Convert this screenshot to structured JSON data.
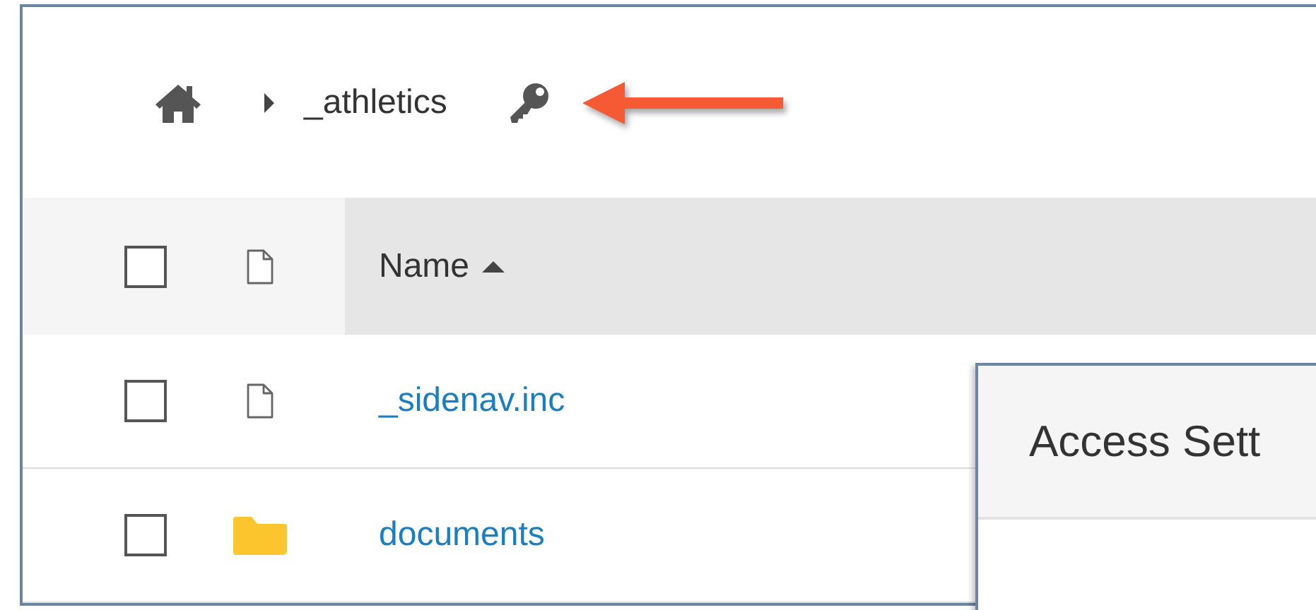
{
  "breadcrumb": {
    "items": [
      {
        "label": "_athletics"
      }
    ],
    "locked": true
  },
  "annotation": {
    "kind": "arrow"
  },
  "table": {
    "select_all": {
      "checked": false
    },
    "columns": [
      {
        "label": "Name",
        "sort_ascending": true
      }
    ],
    "rows": [
      {
        "kind": "file",
        "name": "_sidenav.inc",
        "checked": false
      },
      {
        "kind": "folder",
        "name": "documents",
        "checked": false
      }
    ]
  },
  "dialog": {
    "title": "Access Sett"
  }
}
